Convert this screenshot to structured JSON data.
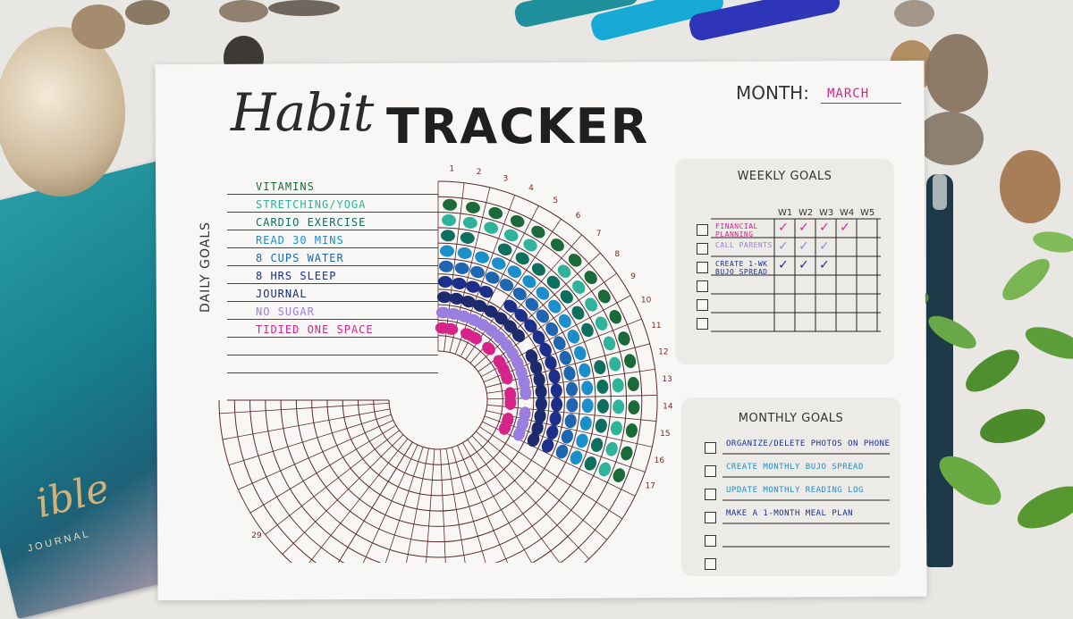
{
  "title": {
    "script": "Habit",
    "main": "TRACKER"
  },
  "month": {
    "label": "MONTH:",
    "value": "MARCH"
  },
  "daily_goals": {
    "title": "DAILY GOALS",
    "items": [
      {
        "label": "VITAMINS",
        "color": "#1b6b3a"
      },
      {
        "label": "STRETCHING/YOGA",
        "color": "#2fb39a"
      },
      {
        "label": "CARDIO EXERCISE",
        "color": "#0f6f5f"
      },
      {
        "label": "READ 30 MINS",
        "color": "#1a8fc9"
      },
      {
        "label": "8 CUPS WATER",
        "color": "#1e66b0"
      },
      {
        "label": "8 HRS SLEEP",
        "color": "#1c2f8a"
      },
      {
        "label": "JOURNAL",
        "color": "#1d2a6e"
      },
      {
        "label": "NO SUGAR",
        "color": "#9a7ee0"
      },
      {
        "label": "TIDIED ONE SPACE",
        "color": "#d6248a"
      }
    ]
  },
  "day_numbers": [
    "1",
    "2",
    "3",
    "4",
    "5",
    "6",
    "7",
    "8",
    "9",
    "10",
    "11",
    "12",
    "13",
    "14",
    "15",
    "16",
    "17",
    "29"
  ],
  "weekly_goals": {
    "title": "WEEKLY GOALS",
    "columns": [
      "W1",
      "W2",
      "W3",
      "W4",
      "W5"
    ],
    "items": [
      {
        "label": "FINANCIAL PLANNING",
        "color": "#d6248a",
        "checks": 4
      },
      {
        "label": "CALL PARENTS",
        "color": "#9a7ee0",
        "checks": 3
      },
      {
        "label": "CREATE 1-WK BUJO SPREAD",
        "color": "#1c2f8a",
        "checks": 3
      },
      {
        "label": "",
        "color": "#333",
        "checks": 0
      },
      {
        "label": "",
        "color": "#333",
        "checks": 0
      },
      {
        "label": "",
        "color": "#333",
        "checks": 0
      }
    ]
  },
  "monthly_goals": {
    "title": "MONTHLY GOALS",
    "items": [
      {
        "label": "ORGANIZE/DELETE PHOTOS ON PHONE",
        "color": "#1c2f8a"
      },
      {
        "label": "CREATE MONTHLY BUJO SPREAD",
        "color": "#1a8fc9"
      },
      {
        "label": "UPDATE MONTHLY READING LOG",
        "color": "#1a8fc9"
      },
      {
        "label": "MAKE A 1-MONTH MEAL PLAN",
        "color": "#1c2f8a"
      },
      {
        "label": "",
        "color": "#333"
      },
      {
        "label": "",
        "color": "#333"
      }
    ]
  },
  "book": {
    "text": "ible",
    "subtext": "JOURNAL"
  }
}
